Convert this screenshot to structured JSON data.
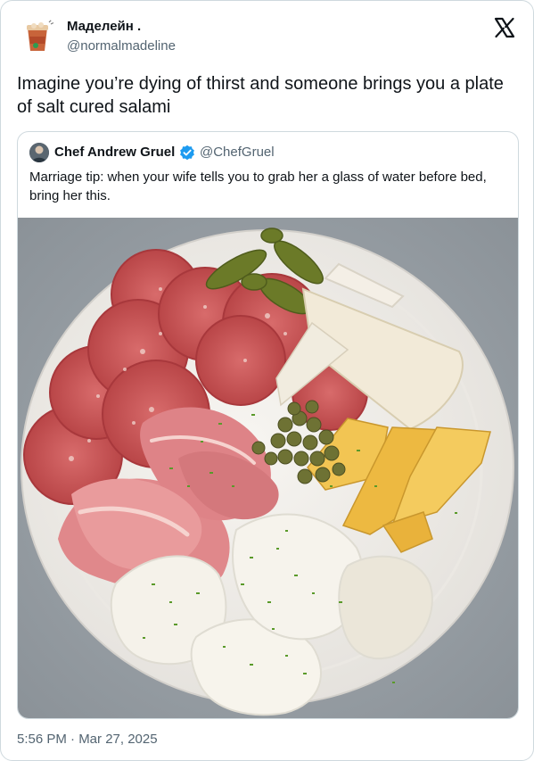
{
  "author": {
    "name": "Маделейн .",
    "handle": "@normalmadeline"
  },
  "tweet": {
    "text": "Imagine you’re dying of thirst and someone brings you a plate of salt cured salami"
  },
  "quoted": {
    "name": "Chef Andrew Gruel",
    "handle": "@ChefGruel",
    "text": "Marriage tip: when your wife tells you to grab her a glass of water before bed, bring her this."
  },
  "footer": {
    "timestamp": "5:56 PM · Mar 27, 2025"
  },
  "icons": {
    "brand": "x-logo-icon",
    "verified": "verified-badge-icon"
  },
  "colors": {
    "verified": "#1d9bf0",
    "secondary_text": "#536471",
    "border": "#cfd9de"
  }
}
